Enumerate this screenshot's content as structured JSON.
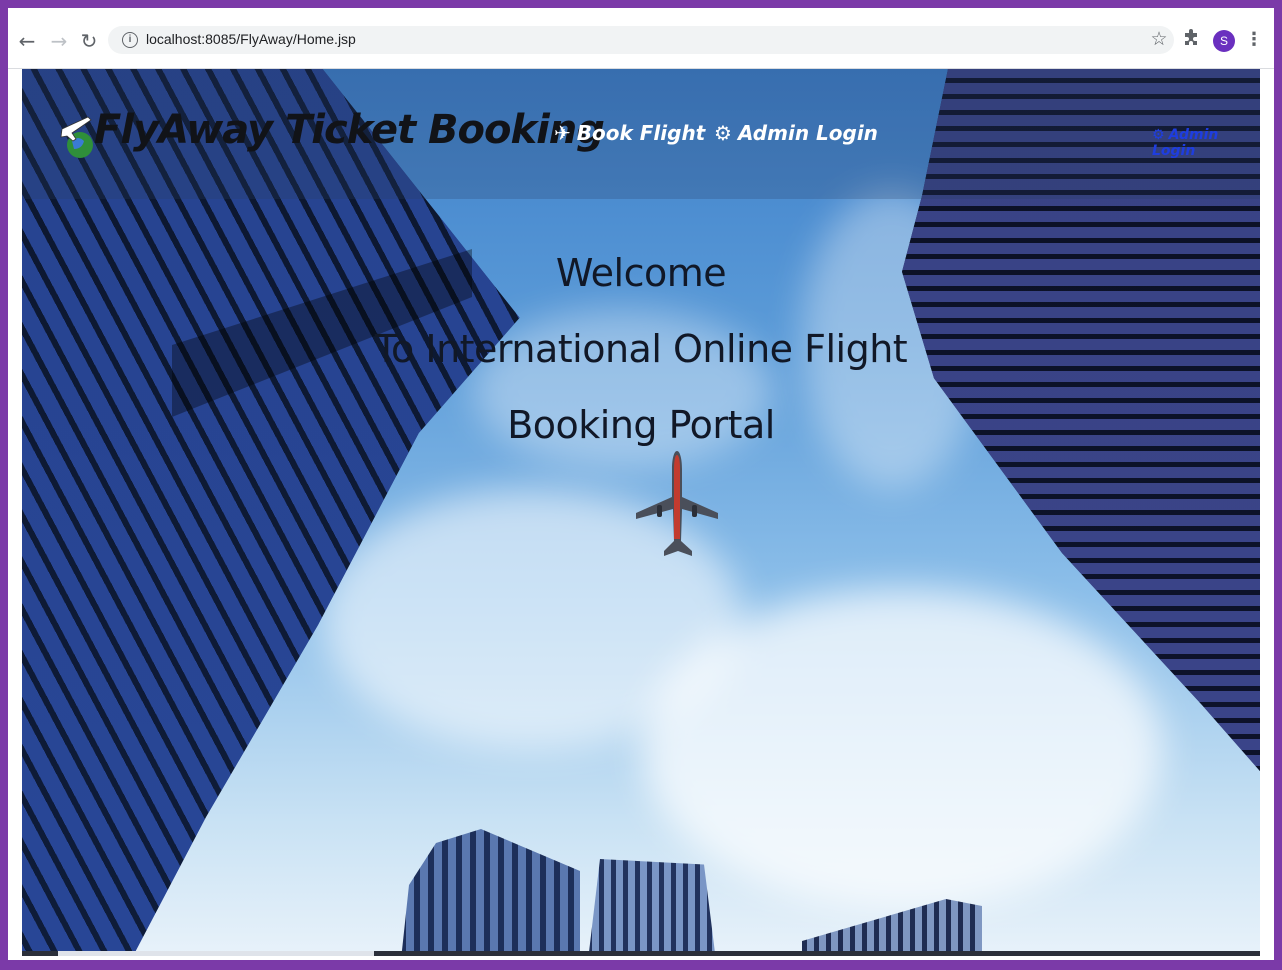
{
  "browser": {
    "back_icon": "arrow-left-icon",
    "forward_icon": "arrow-right-icon",
    "reload_icon": "reload-icon",
    "url": "localhost:8085/FlyAway/Home.jsp",
    "profile_initial": "S"
  },
  "navbar": {
    "brand": "FlyAway Ticket Booking",
    "links": [
      {
        "label": "Book Flight",
        "icon": "plane-icon"
      },
      {
        "label": "Admin Login",
        "icon": "gear-icon"
      }
    ],
    "right_link": {
      "label": "Admin Login",
      "icon": "gear-icon"
    }
  },
  "hero": {
    "line1": "Welcome",
    "line2": "To International Online Flight",
    "line3": "Booking Portal"
  },
  "colors": {
    "frame": "#7b3aa8",
    "nav_text": "#ffffff",
    "right_link": "#1e3de0"
  }
}
